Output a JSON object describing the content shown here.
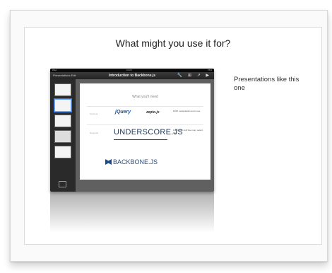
{
  "slide": {
    "title": "What might you use it for?",
    "caption": "Presentations like this one"
  },
  "ipad": {
    "status_left": "iPad",
    "status_center": "10:23",
    "status_right": "76%",
    "nav_left": "Presentations Edit",
    "nav_title": "Introduction to Backbone.js",
    "nav_tools": "🔧 ⊞ ↗ ▶",
    "inner": {
      "need": "What you'll need",
      "row1_label": "Optional",
      "jquery": "jQuery",
      "zepto": "zepto.js",
      "dom_text": "DOM manipulation and more",
      "row2_label": "Required",
      "underscore": "UNDERSCORE.JS",
      "fn_text": "Functional stuff like map, select, filter",
      "backbone": "BACKBONE.JS"
    }
  }
}
